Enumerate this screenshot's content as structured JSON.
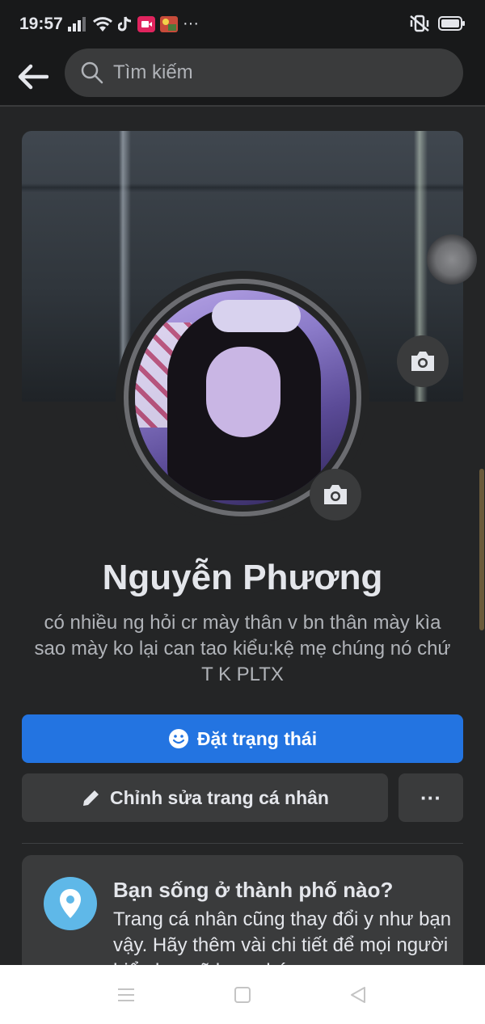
{
  "status_bar": {
    "time": "19:57",
    "more_indicator": "···",
    "icons_left": [
      "signal-icon",
      "wifi-icon",
      "tiktok-icon",
      "screen-record-icon",
      "app-thumbnail-icon"
    ],
    "icons_right": [
      "vibrate-mute-icon",
      "battery-icon"
    ]
  },
  "top_bar": {
    "search_placeholder": "Tìm kiếm"
  },
  "profile": {
    "name": "Nguyễn Phương",
    "bio": "có nhiều ng hỏi cr mày thân v bn thân mày kìa sao mày ko lại can tao kiểu:kệ mẹ chúng nó chứ T K PLTX"
  },
  "actions": {
    "status_label": "Đặt trạng thái",
    "edit_label": "Chỉnh sửa trang cá nhân",
    "more_label": "···"
  },
  "prompt": {
    "title": "Bạn sống ở thành phố nào?",
    "text": "Trang cá nhân cũng thay đổi y như bạn vậy. Hãy thêm vài chi tiết để mọi người hiểu bạn rõ hơn nhé."
  },
  "colors": {
    "background": "#242526",
    "primary": "#2374e1",
    "secondary_button": "#3a3b3c",
    "pin": "#5fb8e8"
  }
}
